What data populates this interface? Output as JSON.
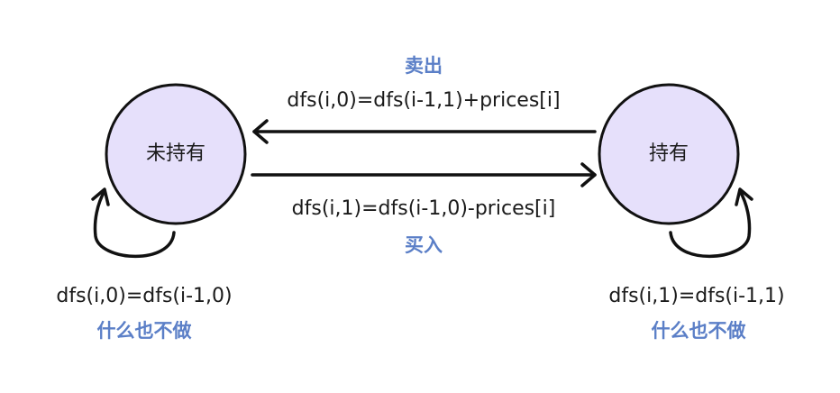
{
  "states": {
    "not_holding": "未持有",
    "holding": "持有"
  },
  "transitions": {
    "sell": {
      "action": "卖出",
      "formula": "dfs(i,0)=dfs(i-1,1)+prices[i]"
    },
    "buy": {
      "action": "买入",
      "formula": "dfs(i,1)=dfs(i-1,0)-prices[i]"
    },
    "stay_not_holding": {
      "formula": "dfs(i,0)=dfs(i-1,0)",
      "action": "什么也不做"
    },
    "stay_holding": {
      "formula": "dfs(i,1)=dfs(i-1,1)",
      "action": "什么也不做"
    }
  },
  "colors": {
    "state_fill": "#e6e0fb",
    "stroke": "#111111",
    "action_text": "#5b7fc7"
  }
}
